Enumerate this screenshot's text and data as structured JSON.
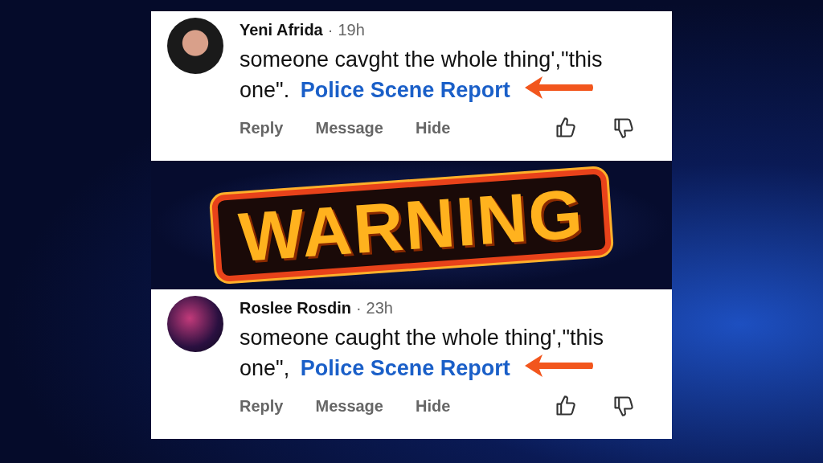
{
  "comments": [
    {
      "author": "Yeni Afrida",
      "separator": "·",
      "time": "19h",
      "text": "someone cavght the whole thing',\"this one\".",
      "link": "Police Scene Report",
      "actions": [
        "Reply",
        "Message",
        "Hide"
      ]
    },
    {
      "author": "Roslee Rosdin",
      "separator": "·",
      "time": "23h",
      "text": "someone caught the whole thing',\"this one\",",
      "link": "Police Scene Report",
      "actions": [
        "Reply",
        "Message",
        "Hide"
      ]
    }
  ],
  "banner": {
    "text": "WARNING"
  }
}
